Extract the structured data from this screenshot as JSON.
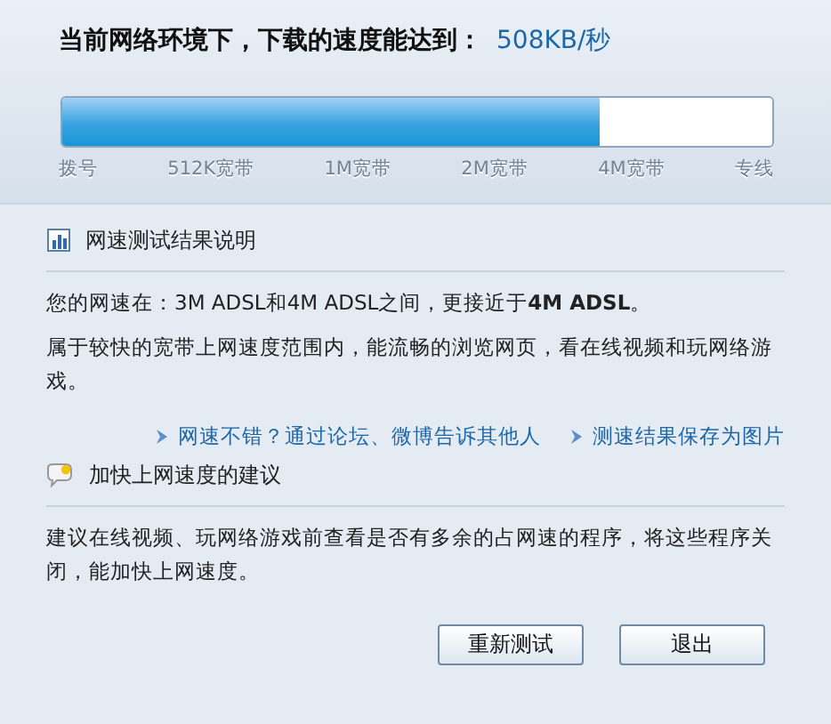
{
  "header": {
    "title": "当前网络环境下，下载的速度能达到：",
    "speed": "508KB/秒"
  },
  "meter": {
    "level": 0.757,
    "ticks": [
      "拨号",
      "512K宽带",
      "1M宽带",
      "2M宽带",
      "4M宽带",
      "专线"
    ]
  },
  "result": {
    "heading": "网速测试结果说明",
    "lines": [
      "您的网速在：3M ADSL和4M ADSL之间，更接近于**4M ADSL**。",
      "属于较快的宽带上网速度范围内，能流畅的浏览网页，看在线视频和玩网络游戏。"
    ],
    "links": [
      "网速不错？通过论坛、微博告诉其他人",
      "测速结果保存为图片"
    ]
  },
  "advice": {
    "heading": "加快上网速度的建议",
    "text": "建议在线视频、玩网络游戏前查看是否有多余的占网速的程序，将这些程序关闭，能加快上网速度。"
  },
  "buttons": [
    "重新测试",
    "退出"
  ]
}
